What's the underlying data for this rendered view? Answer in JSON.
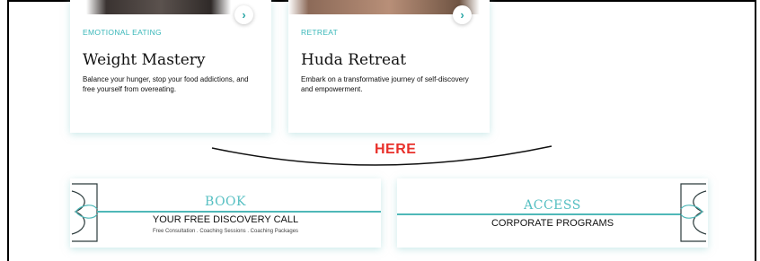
{
  "cards": [
    {
      "category": "EMOTIONAL EATING",
      "title": "Weight Mastery",
      "description": "Balance your hunger, stop your food addictions, and free yourself from overeating.",
      "arrow": "›"
    },
    {
      "category": "RETREAT",
      "title": "Huda Retreat",
      "description": "Embark on a transformative journey of self-discovery and empowerment.",
      "arrow": "›"
    }
  ],
  "annotation": {
    "text": "HERE",
    "color": "#e8302a"
  },
  "banners": {
    "book": {
      "heading": "BOOK",
      "subheading": "YOUR FREE DISCOVERY CALL",
      "details": "Free Consultation . Coaching Sessions . Coaching Packages"
    },
    "access": {
      "heading": "ACCESS",
      "subheading": "CORPORATE PROGRAMS"
    }
  },
  "colors": {
    "accent": "#39b7b9",
    "line": "#4fb8b8"
  }
}
